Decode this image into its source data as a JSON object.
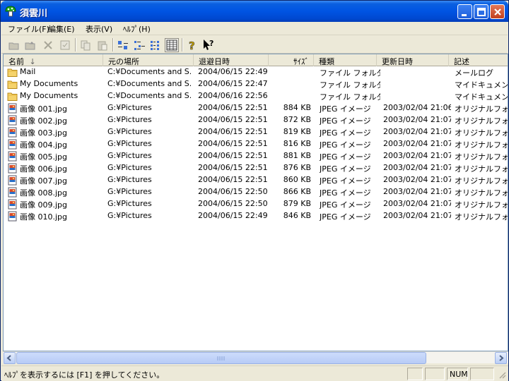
{
  "window": {
    "title": "須雲川"
  },
  "menu": [
    {
      "label": "ファイル(F)"
    },
    {
      "label": "編集(E)"
    },
    {
      "label": "表示(V)"
    },
    {
      "label": "ﾍﾙﾌﾟ(H)"
    }
  ],
  "toolbar": {
    "icons": [
      "open-folder-icon",
      "folder-up-icon",
      "delete-icon",
      "properties-icon",
      "copy-icon",
      "paste-icon",
      "large-icons-icon",
      "small-icons-icon",
      "list-view-icon",
      "details-view-icon",
      "help-icon",
      "whats-this-icon"
    ]
  },
  "columns": [
    {
      "label": "名前",
      "sort": "↓"
    },
    {
      "label": "元の場所"
    },
    {
      "label": "退避日時"
    },
    {
      "label": "ｻｲｽﾞ"
    },
    {
      "label": "種類"
    },
    {
      "label": "更新日時"
    },
    {
      "label": "記述"
    }
  ],
  "rows": [
    {
      "icon": "folder",
      "name": "Mail",
      "orig": "C:¥Documents and S...",
      "deleted": "2004/06/15 22:49",
      "size": "",
      "type": "ファイル フォルダ",
      "modified": "",
      "desc": "メールログ"
    },
    {
      "icon": "folder",
      "name": "My Documents",
      "orig": "C:¥Documents and S...",
      "deleted": "2004/06/15 22:47",
      "size": "",
      "type": "ファイル フォルダ",
      "modified": "",
      "desc": "マイドキュメント"
    },
    {
      "icon": "folder",
      "name": "My Documents",
      "orig": "C:¥Documents and S...",
      "deleted": "2004/06/16 22:56",
      "size": "",
      "type": "ファイル フォルダ",
      "modified": "",
      "desc": "マイドキュメント"
    },
    {
      "icon": "jpeg",
      "name": "画像 001.jpg",
      "orig": "G:¥Pictures",
      "deleted": "2004/06/15 22:51",
      "size": "884 KB",
      "type": "JPEG イメージ",
      "modified": "2003/02/04 21:06",
      "desc": "オリジナルフォト"
    },
    {
      "icon": "jpeg",
      "name": "画像 002.jpg",
      "orig": "G:¥Pictures",
      "deleted": "2004/06/15 22:51",
      "size": "872 KB",
      "type": "JPEG イメージ",
      "modified": "2003/02/04 21:07",
      "desc": "オリジナルフォト"
    },
    {
      "icon": "jpeg",
      "name": "画像 003.jpg",
      "orig": "G:¥Pictures",
      "deleted": "2004/06/15 22:51",
      "size": "819 KB",
      "type": "JPEG イメージ",
      "modified": "2003/02/04 21:07",
      "desc": "オリジナルフォト"
    },
    {
      "icon": "jpeg",
      "name": "画像 004.jpg",
      "orig": "G:¥Pictures",
      "deleted": "2004/06/15 22:51",
      "size": "816 KB",
      "type": "JPEG イメージ",
      "modified": "2003/02/04 21:07",
      "desc": "オリジナルフォト"
    },
    {
      "icon": "jpeg",
      "name": "画像 005.jpg",
      "orig": "G:¥Pictures",
      "deleted": "2004/06/15 22:51",
      "size": "881 KB",
      "type": "JPEG イメージ",
      "modified": "2003/02/04 21:07",
      "desc": "オリジナルフォト"
    },
    {
      "icon": "jpeg",
      "name": "画像 006.jpg",
      "orig": "G:¥Pictures",
      "deleted": "2004/06/15 22:51",
      "size": "876 KB",
      "type": "JPEG イメージ",
      "modified": "2003/02/04 21:07",
      "desc": "オリジナルフォト"
    },
    {
      "icon": "jpeg",
      "name": "画像 007.jpg",
      "orig": "G:¥Pictures",
      "deleted": "2004/06/15 22:51",
      "size": "860 KB",
      "type": "JPEG イメージ",
      "modified": "2003/02/04 21:07",
      "desc": "オリジナルフォト"
    },
    {
      "icon": "jpeg",
      "name": "画像 008.jpg",
      "orig": "G:¥Pictures",
      "deleted": "2004/06/15 22:50",
      "size": "866 KB",
      "type": "JPEG イメージ",
      "modified": "2003/02/04 21:07",
      "desc": "オリジナルフォト"
    },
    {
      "icon": "jpeg",
      "name": "画像 009.jpg",
      "orig": "G:¥Pictures",
      "deleted": "2004/06/15 22:50",
      "size": "879 KB",
      "type": "JPEG イメージ",
      "modified": "2003/02/04 21:07",
      "desc": "オリジナルフォト"
    },
    {
      "icon": "jpeg",
      "name": "画像 010.jpg",
      "orig": "G:¥Pictures",
      "deleted": "2004/06/15 22:49",
      "size": "846 KB",
      "type": "JPEG イメージ",
      "modified": "2003/02/04 21:07",
      "desc": "オリジナルフォト"
    }
  ],
  "status": {
    "text": "ﾍﾙﾌﾟを表示するには [F1] を押してください。",
    "num": "NUM"
  },
  "colors": {
    "title_bar": "#0054e3",
    "folder": "#f5d36b",
    "selection": "#316ac5"
  }
}
